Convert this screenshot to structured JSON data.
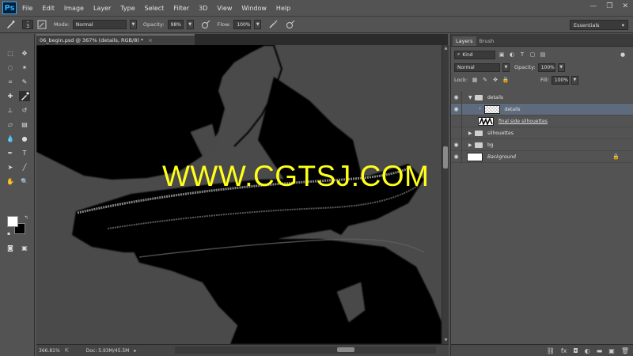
{
  "app": {
    "logo_text": "Ps"
  },
  "menu": [
    "File",
    "Edit",
    "Image",
    "Layer",
    "Type",
    "Select",
    "Filter",
    "3D",
    "View",
    "Window",
    "Help"
  ],
  "window_controls": {
    "minimize": "—",
    "restore": "❐",
    "close": "✕"
  },
  "options": {
    "brush_size": "3",
    "mode_label": "Mode:",
    "mode_value": "Normal",
    "opacity_label": "Opacity:",
    "opacity_value": "98%",
    "flow_label": "Flow:",
    "flow_value": "100%",
    "workspace": "Essentials"
  },
  "document": {
    "tab_title": "06_begin.psd @ 367% (details, RGB/8) *",
    "close": "×",
    "zoom": "366.81%",
    "doc_info": "Doc: 5.93M/45.5M",
    "watermark": "WWW.CGTSJ.COM"
  },
  "layers_panel": {
    "tabs": [
      "Layers",
      "Brush"
    ],
    "filter_kind": "Kind",
    "blend_mode": "Normal",
    "opacity_label": "Opacity:",
    "opacity_value": "100%",
    "lock_label": "Lock:",
    "fill_label": "Fill:",
    "fill_value": "100%",
    "layers": [
      {
        "name": "details",
        "type": "group",
        "expanded": true,
        "visible": true
      },
      {
        "name": "details",
        "type": "layer",
        "selected": true,
        "visible": true
      },
      {
        "name": "final side silhouettes",
        "type": "layer",
        "visible": false
      },
      {
        "name": "silhouettes",
        "type": "group",
        "expanded": false,
        "visible": false
      },
      {
        "name": "bg",
        "type": "group",
        "expanded": false,
        "visible": true
      },
      {
        "name": "Background",
        "type": "background",
        "visible": true,
        "locked": true
      }
    ]
  },
  "colors": {
    "ui_bg": "#535353",
    "canvas_bg": "#4a4a4a",
    "watermark": "#ffff1a",
    "selection": "#5d6b7c"
  }
}
